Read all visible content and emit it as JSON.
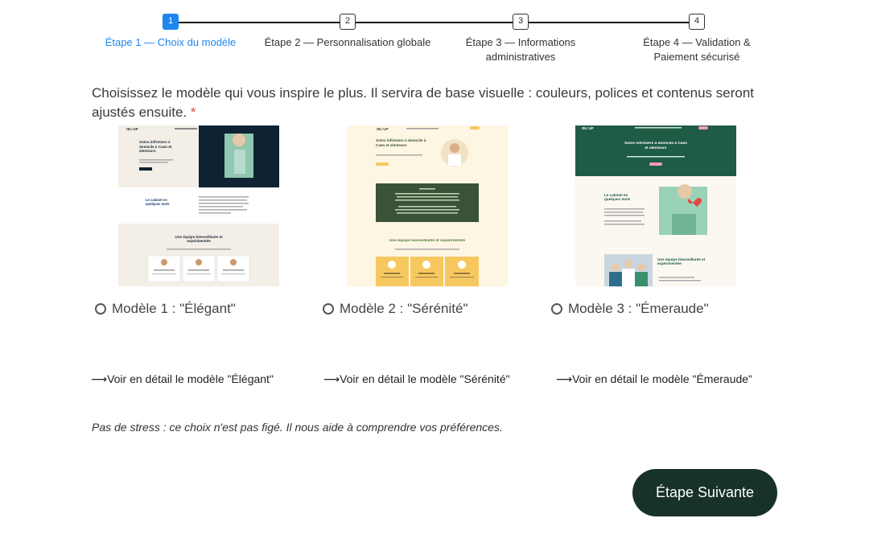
{
  "stepper": {
    "steps": [
      {
        "number": "1",
        "label": "Étape 1 — Choix du modèle"
      },
      {
        "number": "2",
        "label": "Étape 2 — Personnalisation globale"
      },
      {
        "number": "3",
        "label": "Étape 3 — Informations administratives"
      },
      {
        "number": "4",
        "label": "Étape 4 — Validation & Paiement sécurisé"
      }
    ],
    "active_step": 1,
    "active_color": "#1e86f0"
  },
  "intro": {
    "text": "Choisissez le modèle qui vous inspire le plus. Il servira de base visuelle : couleurs, polices et contenus seront ajustés ensuite.",
    "required_mark": "*"
  },
  "models": [
    {
      "option_label": "Modèle 1 : \"Élégant\"",
      "detail_link": "⟶Voir en détail le modèle \"Élégant\"",
      "preview": {
        "logo": "ŒL'UP",
        "hero_title": "Soins infirmiers à domicile à Caen et alentours",
        "section_title": "Le cabinet en quelques mots",
        "team_title": "Une équipe bienveillante et expérimentée"
      }
    },
    {
      "option_label": "Modèle 2 : \"Sérénité\"",
      "detail_link": "⟶Voir en détail le modèle \"Sérénité\"",
      "preview": {
        "logo": "ŒL'UP",
        "hero_title": "Soins infirmiers à domicile à Caen et alentours",
        "team_title": "Une équipe bienveillante et expérimentée"
      }
    },
    {
      "option_label": "Modèle 3 : \"Émeraude\"",
      "detail_link": "⟶Voir en détail le modèle \"Émeraude\"",
      "preview": {
        "logo": "ŒL'UP",
        "hero_title": "Soins infirmiers à domicile à Caen et alentours",
        "section_title": "Le cabinet en quelques mots",
        "team_title": "Une équipe bienveillante et expérimentée"
      }
    }
  ],
  "note": "Pas de stress : ce choix n'est pas figé. Il nous aide à comprendre vos préférences.",
  "next_button": "Étape Suivante",
  "colors": {
    "primary_dark": "#17312b",
    "required": "#e04848",
    "emerald": "#1f5c45",
    "serenite_bg": "#fdf6e3",
    "serenite_dark": "#3a5237",
    "serenite_yellow": "#f6c85f",
    "elegant_navy": "#0e2233"
  }
}
